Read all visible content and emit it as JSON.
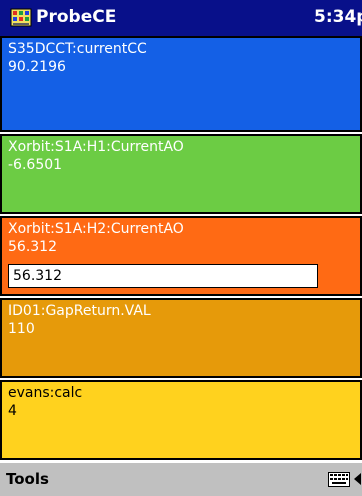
{
  "titlebar": {
    "app_title": "ProbeCE",
    "clock": "5:34p",
    "icon": "probe-app-icon"
  },
  "panels": [
    {
      "pv": "S35DCCT:currentCC",
      "value": "90.2196",
      "color": "#1460e6"
    },
    {
      "pv": "Xorbit:S1A:H1:CurrentAO",
      "value": "-6.6501",
      "color": "#6ccc44"
    },
    {
      "pv": "Xorbit:S1A:H2:CurrentAO",
      "value": "56.312",
      "input_value": "56.312",
      "color": "#ff6a14"
    },
    {
      "pv": "ID01:GapReturn.VAL",
      "value": "110",
      "color": "#e69a0a"
    },
    {
      "pv": "evans:calc",
      "value": "4",
      "color": "#ffd21e"
    }
  ],
  "menubar": {
    "tools_label": "Tools",
    "icons": [
      "keyboard-icon",
      "sip-arrow-icon"
    ]
  },
  "colors": {
    "titlebar": "#08108a",
    "menubar": "#c0c0c0"
  }
}
